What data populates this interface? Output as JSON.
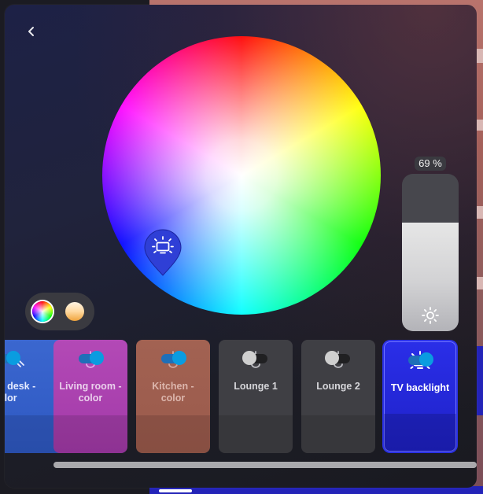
{
  "brightness": {
    "value_text": "69 %",
    "level_percent": 69
  },
  "colors": {
    "accent_blue": "#2b31e6",
    "toggle_on": "#0a9ce0",
    "toggle_off_knob": "#cfcfcf"
  },
  "icons": {
    "back": "chevron-left-icon",
    "brightness": "sun-icon",
    "lamp": "ceiling-lamp-icon",
    "tv": "tv-backlight-icon",
    "strip": "led-strip-icon"
  },
  "modes": [
    {
      "name": "color",
      "selected": true
    },
    {
      "name": "temperature",
      "selected": false
    }
  ],
  "devices": [
    {
      "name": "n desk -\nolor",
      "on": true,
      "icon": "led-strip-icon",
      "selected": false
    },
    {
      "name": "Living room -\ncolor",
      "on": true,
      "icon": "ceiling-lamp-icon",
      "selected": false
    },
    {
      "name": "Kitchen - color",
      "on": true,
      "icon": "ceiling-lamp-icon",
      "selected": false
    },
    {
      "name": "Lounge 1",
      "on": false,
      "icon": "ceiling-lamp-icon",
      "selected": false
    },
    {
      "name": "Lounge 2",
      "on": false,
      "icon": "ceiling-lamp-icon",
      "selected": false
    },
    {
      "name": "TV backlight",
      "on": true,
      "icon": "tv-backlight-icon",
      "selected": true
    }
  ]
}
